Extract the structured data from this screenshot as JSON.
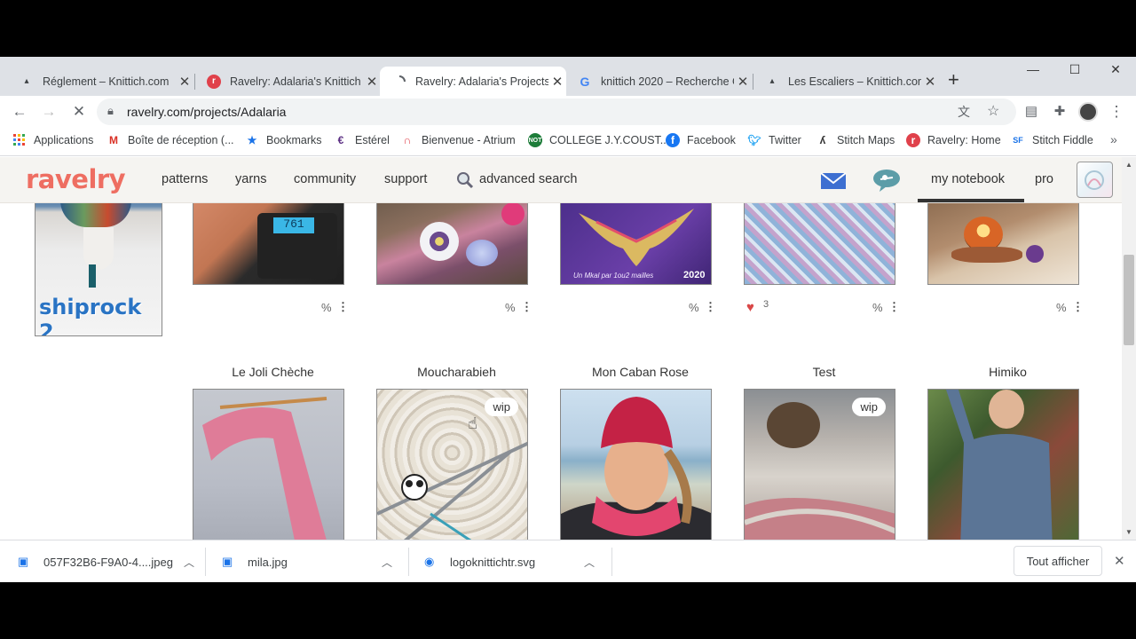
{
  "browser": {
    "tabs": [
      {
        "title": "Réglement – Knittich.com",
        "icon": "knittich-icon"
      },
      {
        "title": "Ravelry: Adalaria's Knittich",
        "icon": "ravelry-icon"
      },
      {
        "title": "Ravelry: Adalaria's Projects",
        "icon": "loading-icon"
      },
      {
        "title": "knittich 2020 – Recherche G",
        "icon": "google-icon"
      },
      {
        "title": "Les Escaliers – Knittich.com",
        "icon": "knittich-icon"
      }
    ],
    "new_tab": "+",
    "url": "ravelry.com/projects/Adalaria",
    "bookmarks": [
      {
        "label": "Applications",
        "icon": "apps-grid-icon"
      },
      {
        "label": "Boîte de réception (...",
        "icon": "gmail-icon"
      },
      {
        "label": "Bookmarks",
        "icon": "star-icon"
      },
      {
        "label": "Estérel",
        "icon": "esterel-icon"
      },
      {
        "label": "Bienvenue - Atrium",
        "icon": "atrium-icon"
      },
      {
        "label": "COLLEGE J.Y.COUST...",
        "icon": "college-icon"
      },
      {
        "label": "Facebook",
        "icon": "facebook-icon"
      },
      {
        "label": "Twitter",
        "icon": "twitter-icon"
      },
      {
        "label": "Stitch Maps",
        "icon": "stitchmaps-icon"
      },
      {
        "label": "Ravelry: Home",
        "icon": "ravelry-icon"
      },
      {
        "label": "Stitch Fiddle",
        "icon": "stitchfiddle-icon"
      }
    ]
  },
  "ravelry": {
    "logo": "ravelry",
    "nav": [
      "patterns",
      "yarns",
      "community",
      "support",
      "advanced search",
      "my notebook",
      "pro"
    ],
    "colors": {
      "logo": "#ee6e62",
      "heart": "#d94848"
    }
  },
  "projects": {
    "top_left_caption": "shiprock 2",
    "row1_meta": [
      {
        "percent": "%",
        "hearts": ""
      },
      {
        "percent": "%",
        "hearts": ""
      },
      {
        "percent": "%",
        "hearts": ""
      },
      {
        "percent": "%",
        "hearts": "3"
      },
      {
        "percent": "%",
        "hearts": ""
      }
    ],
    "row1_overlays": {
      "scale_display": "761",
      "card_text": "Un Mkal par 1ou2 mailles",
      "card_year": "2020"
    },
    "row2": [
      {
        "title": "Le Joli Chèche",
        "badge": ""
      },
      {
        "title": "Moucharabieh",
        "badge": "wip"
      },
      {
        "title": "Mon Caban Rose",
        "badge": ""
      },
      {
        "title": "Test",
        "badge": "wip"
      },
      {
        "title": "Himiko",
        "badge": ""
      }
    ]
  },
  "downloads": {
    "items": [
      "057F32B6-F9A0-4....jpeg",
      "mila.jpg",
      "logoknittichtr.svg"
    ],
    "show_all": "Tout afficher"
  }
}
